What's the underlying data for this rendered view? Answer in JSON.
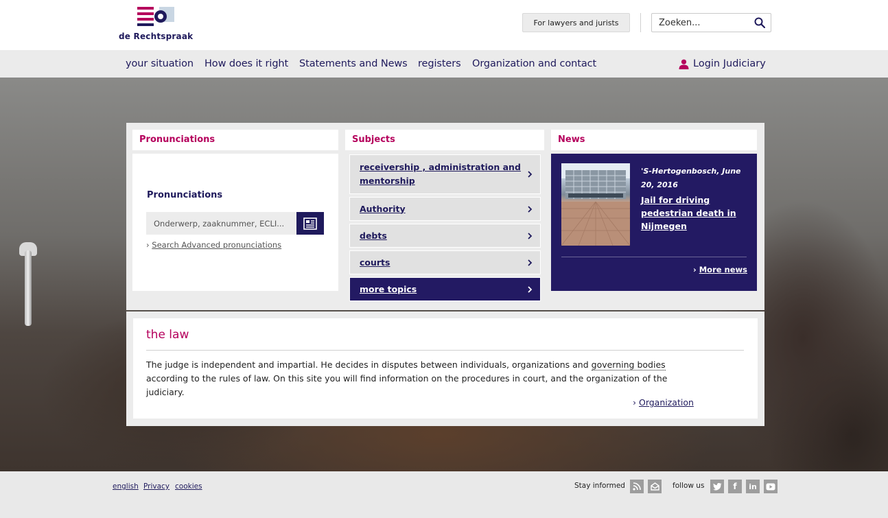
{
  "brand": {
    "name": "de Rechtspraak"
  },
  "header": {
    "lawyers_button": "For lawyers and jurists",
    "search_placeholder": "Zoeken..."
  },
  "nav": {
    "items": [
      "your situation",
      "How does it right",
      "Statements and News",
      "registers",
      "Organization and contact"
    ],
    "login": "Login Judiciary"
  },
  "pronunciations": {
    "heading": "Pronunciations",
    "title": "Pronunciations",
    "input_placeholder": "Onderwerp, zaaknummer, ECLI...",
    "advanced_link": "Search Advanced pronunciations"
  },
  "subjects": {
    "heading": "Subjects",
    "items": [
      "receivership , administration and mentorship",
      "Authority",
      "debts",
      "courts",
      "more topics"
    ]
  },
  "news": {
    "heading": "News",
    "date": "'S-Hertogenbosch, June 20, 2016",
    "title": "Jail for driving pedestrian death in Nijmegen",
    "more": "More news"
  },
  "law": {
    "title": "the law",
    "text_before": "The judge is independent and impartial. He decides in disputes between individuals, organizations and ",
    "text_term": "governing bodies",
    "text_after": " according to the rules of law. On this site you will find information on the procedures in court, and the organization of the judiciary.",
    "link": "Organization"
  },
  "footer": {
    "links": [
      "english",
      "Privacy",
      "cookies"
    ],
    "stay_informed": "Stay informed",
    "follow_us": "follow us"
  },
  "colors": {
    "accent": "#b5005c",
    "navy": "#231a63"
  }
}
